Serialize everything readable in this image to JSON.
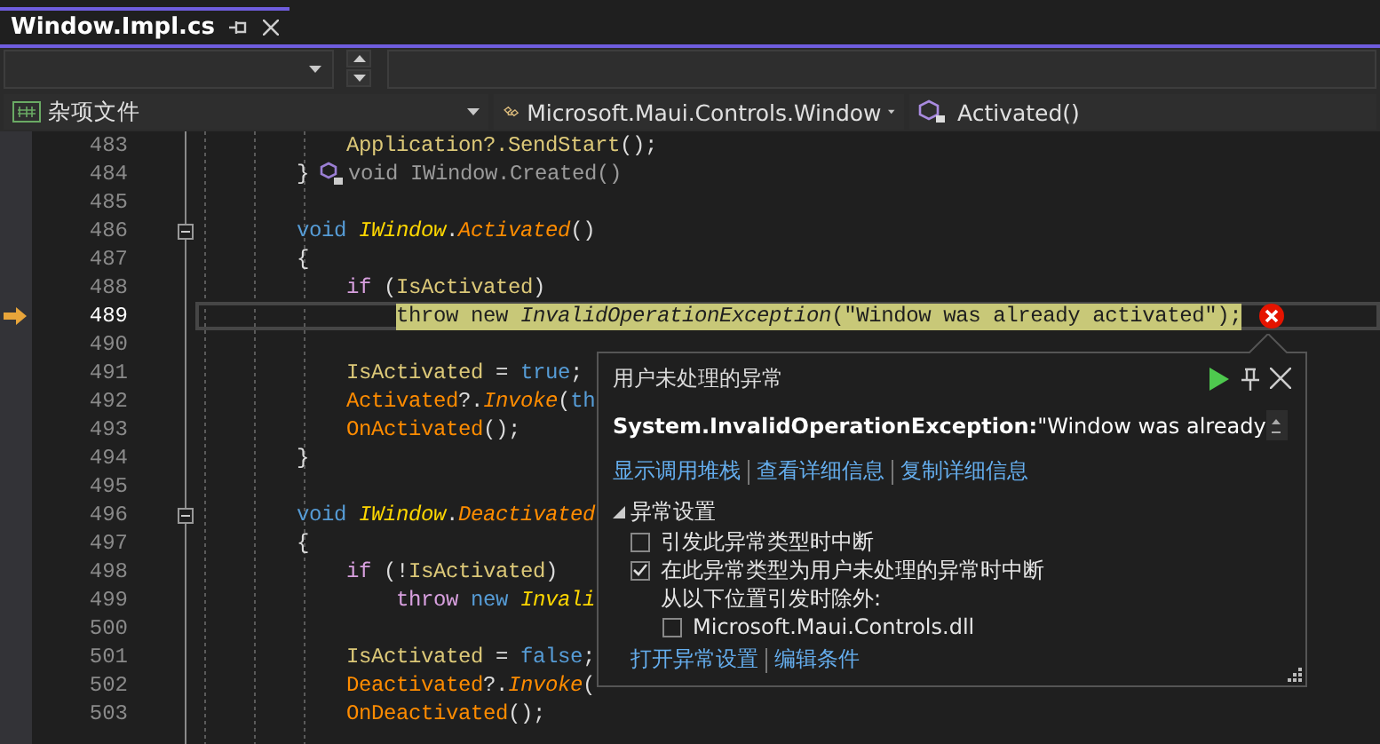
{
  "tab": {
    "title": "Window.Impl.cs",
    "selected": true
  },
  "navigation": {
    "project": "杂项文件",
    "type": "Microsoft.Maui.Controls.Window",
    "member": "Activated()"
  },
  "editor": {
    "lines": [
      {
        "number": "483",
        "kind": "statement",
        "current": false,
        "error": false,
        "fold": false,
        "tokens": [
          {
            "kind": "member",
            "text": "Application?.SendStart"
          },
          {
            "kind": "plain",
            "text": "();"
          }
        ]
      },
      {
        "number": "484",
        "kind": "member",
        "current": false,
        "error": false,
        "fold": false,
        "tokens": [
          {
            "kind": "plain",
            "text": "}"
          },
          {
            "kind": "hint",
            "text": "void IWindow.Created()"
          }
        ]
      },
      {
        "number": "485",
        "kind": "blank",
        "current": false,
        "error": false,
        "fold": false
      },
      {
        "number": "486",
        "kind": "member",
        "current": false,
        "error": false,
        "fold": true,
        "tokens": [
          {
            "kind": "keyword",
            "text": "void "
          },
          {
            "kind": "interface",
            "text": "IWindow"
          },
          {
            "kind": "plain",
            "text": "."
          },
          {
            "kind": "method",
            "text": "Activated"
          },
          {
            "kind": "plain",
            "text": "()"
          }
        ]
      },
      {
        "number": "487",
        "kind": "member",
        "current": false,
        "error": false,
        "fold": false,
        "tokens": [
          {
            "kind": "plain",
            "text": "{"
          }
        ]
      },
      {
        "number": "488",
        "kind": "statement",
        "current": false,
        "error": false,
        "fold": false,
        "tokens": [
          {
            "kind": "control",
            "text": "if "
          },
          {
            "kind": "plain",
            "text": "("
          },
          {
            "kind": "member",
            "text": "IsActivated"
          },
          {
            "kind": "plain",
            "text": ")"
          }
        ]
      },
      {
        "number": "489",
        "kind": "nested",
        "current": true,
        "error": true,
        "fold": false,
        "tokens": [
          {
            "kind": "control",
            "text": "throw "
          },
          {
            "kind": "keyword",
            "text": "new "
          },
          {
            "kind": "interface",
            "text": "InvalidOperationException"
          },
          {
            "kind": "plain",
            "text": "(\"Window was already activated\");"
          }
        ]
      },
      {
        "number": "490",
        "kind": "blank",
        "current": false,
        "error": false,
        "fold": false
      },
      {
        "number": "491",
        "kind": "statement",
        "current": false,
        "error": false,
        "fold": false,
        "tokens": [
          {
            "kind": "member",
            "text": "IsActivated"
          },
          {
            "kind": "plain",
            "text": " = "
          },
          {
            "kind": "keyword",
            "text": "true"
          },
          {
            "kind": "plain",
            "text": ";"
          }
        ]
      },
      {
        "number": "492",
        "kind": "statement",
        "current": false,
        "error": false,
        "fold": false,
        "tokens": [
          {
            "kind": "event",
            "text": "Activated"
          },
          {
            "kind": "plain",
            "text": "?."
          },
          {
            "kind": "method",
            "text": "Invoke"
          },
          {
            "kind": "plain",
            "text": "("
          },
          {
            "kind": "keyword",
            "text": "th"
          }
        ]
      },
      {
        "number": "493",
        "kind": "statement",
        "current": false,
        "error": false,
        "fold": false,
        "tokens": [
          {
            "kind": "event",
            "text": "OnActivated"
          },
          {
            "kind": "plain",
            "text": "();"
          }
        ]
      },
      {
        "number": "494",
        "kind": "member",
        "current": false,
        "error": false,
        "fold": false,
        "tokens": [
          {
            "kind": "plain",
            "text": "}"
          }
        ]
      },
      {
        "number": "495",
        "kind": "blank",
        "current": false,
        "error": false,
        "fold": false
      },
      {
        "number": "496",
        "kind": "member",
        "current": false,
        "error": false,
        "fold": true,
        "tokens": [
          {
            "kind": "keyword",
            "text": "void "
          },
          {
            "kind": "interface",
            "text": "IWindow"
          },
          {
            "kind": "plain",
            "text": "."
          },
          {
            "kind": "method",
            "text": "Deactivated"
          }
        ]
      },
      {
        "number": "497",
        "kind": "member",
        "current": false,
        "error": false,
        "fold": false,
        "tokens": [
          {
            "kind": "plain",
            "text": "{"
          }
        ]
      },
      {
        "number": "498",
        "kind": "statement",
        "current": false,
        "error": false,
        "fold": false,
        "tokens": [
          {
            "kind": "control",
            "text": "if "
          },
          {
            "kind": "plain",
            "text": "(!"
          },
          {
            "kind": "member",
            "text": "IsActivated"
          },
          {
            "kind": "plain",
            "text": ")"
          }
        ]
      },
      {
        "number": "499",
        "kind": "nested",
        "current": false,
        "error": false,
        "fold": false,
        "tokens": [
          {
            "kind": "control",
            "text": "throw "
          },
          {
            "kind": "keyword",
            "text": "new "
          },
          {
            "kind": "interface",
            "text": "Invali"
          }
        ]
      },
      {
        "number": "500",
        "kind": "blank",
        "current": false,
        "error": false,
        "fold": false
      },
      {
        "number": "501",
        "kind": "statement",
        "current": false,
        "error": false,
        "fold": false,
        "tokens": [
          {
            "kind": "member",
            "text": "IsActivated"
          },
          {
            "kind": "plain",
            "text": " = "
          },
          {
            "kind": "keyword",
            "text": "false"
          },
          {
            "kind": "plain",
            "text": ";"
          }
        ]
      },
      {
        "number": "502",
        "kind": "statement",
        "current": false,
        "error": false,
        "fold": false,
        "tokens": [
          {
            "kind": "event",
            "text": "Deactivated"
          },
          {
            "kind": "plain",
            "text": "?."
          },
          {
            "kind": "method",
            "text": "Invoke"
          },
          {
            "kind": "plain",
            "text": "("
          }
        ]
      },
      {
        "number": "503",
        "kind": "statement",
        "current": false,
        "error": false,
        "fold": false,
        "tokens": [
          {
            "kind": "event",
            "text": "OnDeactivated"
          },
          {
            "kind": "plain",
            "text": "();"
          }
        ]
      }
    ]
  },
  "exception_popup": {
    "title": "用户未处理的异常",
    "message": "**System.InvalidOperationException:**\"Window was already",
    "links": [
      "显示调用堆栈",
      "查看详细信息",
      "复制详细信息"
    ],
    "settings": {
      "title": "异常设置",
      "expanded": true,
      "options": [
        {
          "kind": "checkbox",
          "label": "引发此异常类型时中断",
          "checked": false
        },
        {
          "kind": "checkbox",
          "label": "在此异常类型为用户未处理的异常时中断",
          "checked": true
        },
        {
          "kind": "note",
          "label": "从以下位置引发时除外:"
        },
        {
          "kind": "sub-checkbox",
          "label": "Microsoft.Maui.Controls.dll",
          "checked": false
        }
      ]
    },
    "footer_links": [
      "打开异常设置",
      "编辑条件"
    ]
  }
}
